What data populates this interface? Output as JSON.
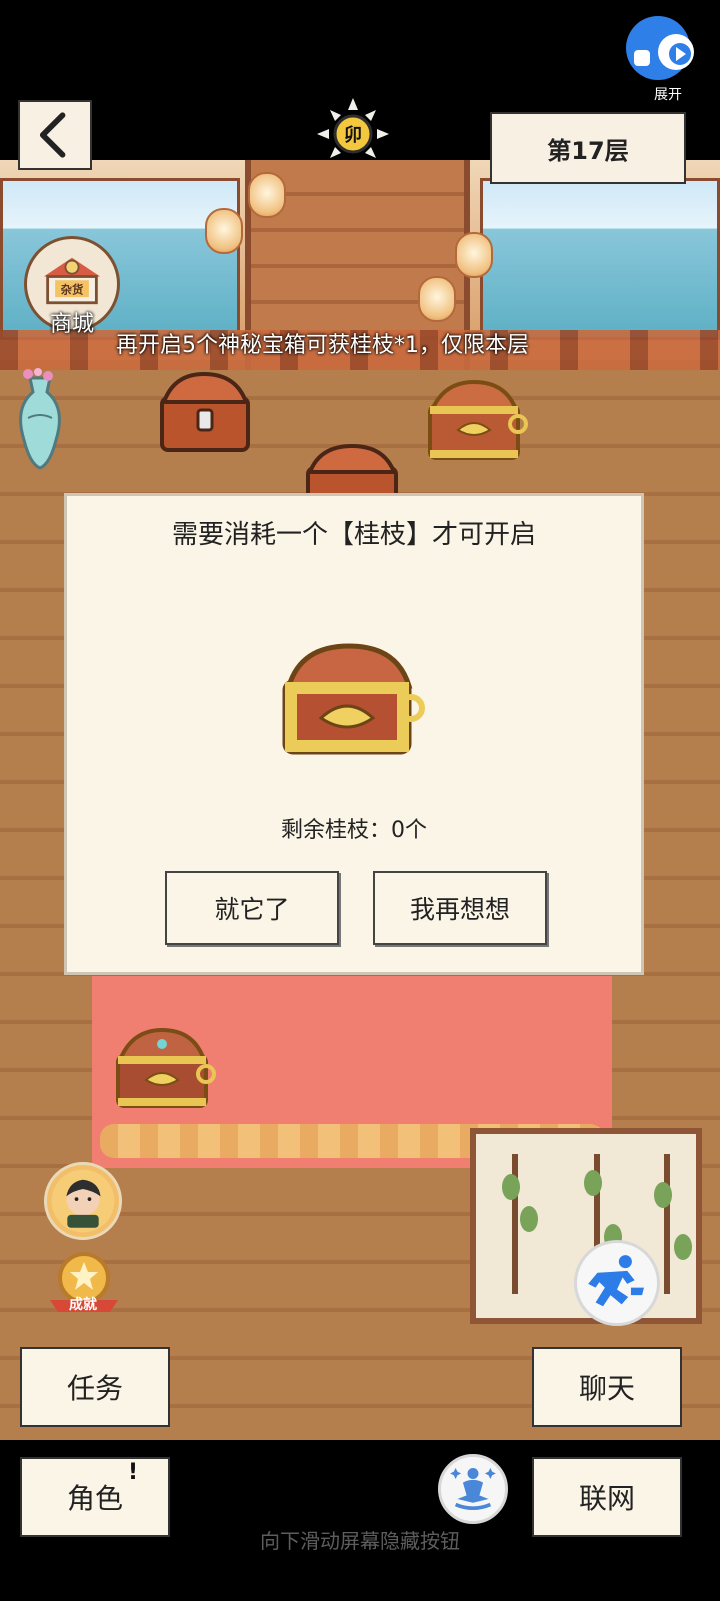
{
  "top_right": {
    "expand_label": "展开"
  },
  "header": {
    "floor_label": "第17层",
    "sun_badge_label": "卯"
  },
  "shop": {
    "label": "商城",
    "sign_text": "杂货"
  },
  "hint": {
    "text": "再开启5个神秘宝箱可获桂枝*1，仅限本层"
  },
  "dialog": {
    "title": "需要消耗一个【桂枝】才可开启",
    "remaining_label": "剩余桂枝：0个",
    "confirm_label": "就它了",
    "cancel_label": "我再想想"
  },
  "side": {
    "achievement_label": "成就"
  },
  "bottom": {
    "task_label": "任务",
    "chat_label": "聊天",
    "role_label": "角色",
    "network_label": "联网",
    "alert_mark": "!",
    "hint_text": "向下滑动屏幕隐藏按钮"
  }
}
